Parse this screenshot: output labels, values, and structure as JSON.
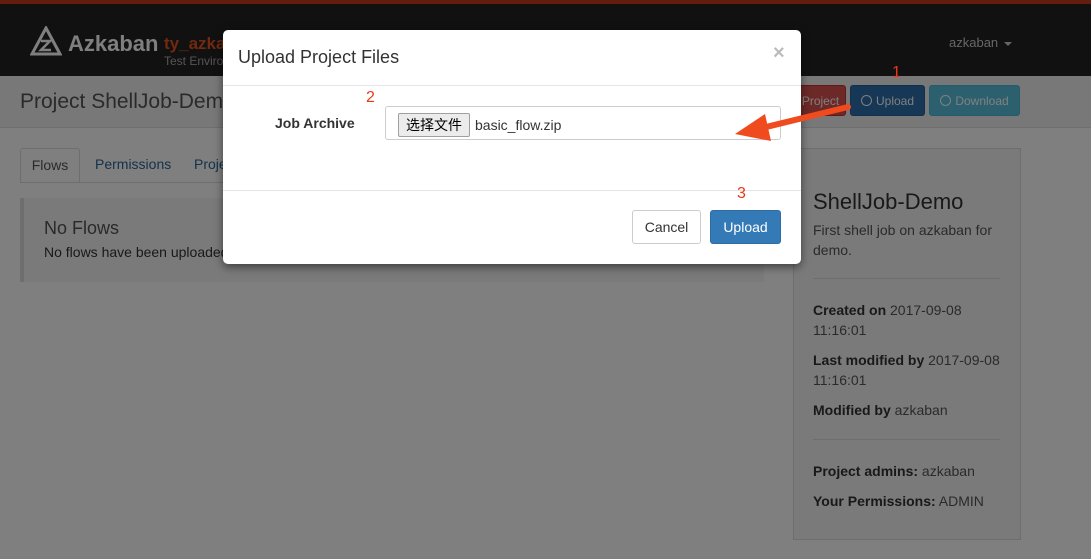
{
  "navbar": {
    "brand": "Azkaban",
    "instance": "ty_azka",
    "environment": "Test Enviro",
    "user": "azkaban"
  },
  "project": {
    "title": "Project ShellJob-Demo",
    "buttons": {
      "delete": "Project",
      "upload": "Upload",
      "download": "Download"
    }
  },
  "tabs": [
    "Flows",
    "Permissions",
    "Proje"
  ],
  "flows": {
    "title": "No Flows",
    "message": "No flows have been uploaded"
  },
  "sidebar": {
    "name": "ShellJob-Demo",
    "description": "First shell job on azkaban for demo.",
    "created_label": "Created on",
    "created_value": "2017-09-08 11:16:01",
    "modified_label": "Last modified by",
    "modified_value": "2017-09-08 11:16:01",
    "modified_by_label": "Modified by",
    "modified_by_value": "azkaban",
    "admins_label": "Project admins:",
    "admins_value": "azkaban",
    "permissions_label": "Your Permissions:",
    "permissions_value": "ADMIN"
  },
  "modal": {
    "title": "Upload Project Files",
    "close": "×",
    "field_label": "Job Archive",
    "file_button": "选择文件",
    "file_name": "basic_flow.zip",
    "cancel": "Cancel",
    "upload": "Upload"
  },
  "annotations": [
    "1",
    "2",
    "3"
  ],
  "colors": {
    "annotation": "#e8391a",
    "primary": "#337ab7",
    "navbar": "#222222"
  }
}
